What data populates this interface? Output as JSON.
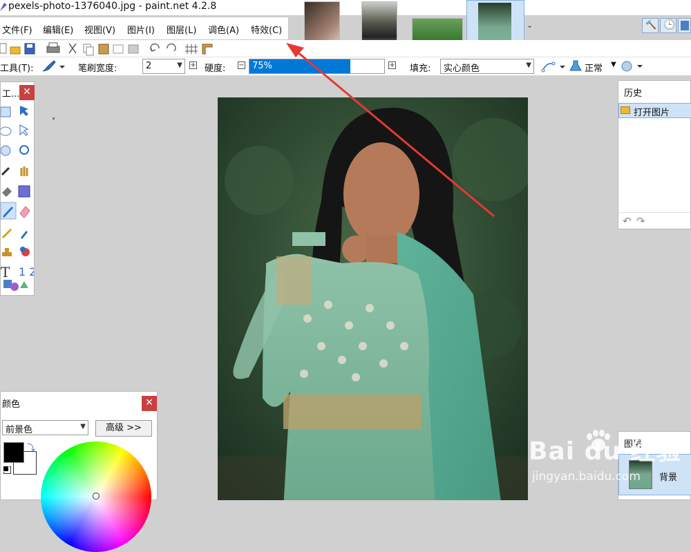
{
  "window": {
    "title": "pexels-photo-1376040.jpg - paint.net 4.2.8"
  },
  "menu": [
    {
      "id": "file",
      "label": "文件(F)"
    },
    {
      "id": "edit",
      "label": "编辑(E)"
    },
    {
      "id": "view",
      "label": "视图(V)"
    },
    {
      "id": "image",
      "label": "图片(I)"
    },
    {
      "id": "layers",
      "label": "图层(L)"
    },
    {
      "id": "adjust",
      "label": "调色(A)"
    },
    {
      "id": "effects",
      "label": "特效(C)"
    }
  ],
  "toolbar": {
    "tool_label": "工具(T):",
    "brush_width_label": "笔刷宽度:",
    "brush_width_value": "2",
    "hardness_label": "硬度:",
    "hardness_value": "75%",
    "hardness_fraction": 0.75,
    "fill_label": "填充:",
    "fill_value": "实心颜色",
    "blend_label": "正常"
  },
  "tools_panel": {
    "title": "工..."
  },
  "history_panel": {
    "title": "历史",
    "items": [
      "打开图片"
    ]
  },
  "colors_panel": {
    "title": "颜色",
    "mode": "前景色",
    "more_button": "高级 >>"
  },
  "layers_panel": {
    "title": "图层",
    "items": [
      "背景"
    ]
  },
  "watermark": {
    "logo": "Bai du 经验",
    "url": "jingyan.baidu.com"
  },
  "colors": {
    "accent": "#0078d7",
    "close": "#c94040",
    "arrow": "#e53935",
    "selected": "#cfe3f7"
  }
}
